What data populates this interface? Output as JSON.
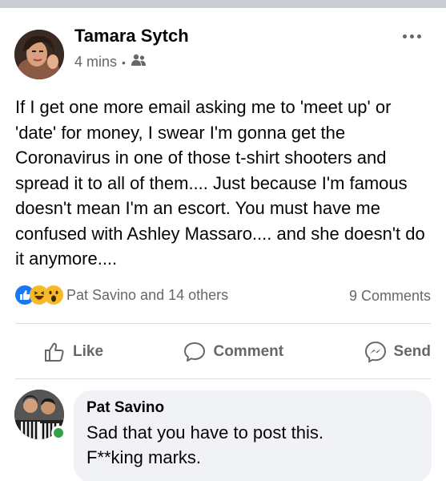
{
  "post": {
    "author": "Tamara Sytch",
    "time": "4 mins",
    "audience_icon": "friends-icon",
    "text": "If I get one more email asking me to 'meet up' or 'date' for money, I swear I'm gonna get the Coronavirus in one of those t-shirt shooters and spread it to all of them.... Just because I'm famous doesn't mean I'm an escort. You must have me confused with Ashley Massaro.... and she doesn't do it anymore....",
    "reactions": {
      "icons": [
        "like-icon",
        "haha-icon",
        "wow-icon"
      ],
      "names": "Pat Savino and 14 others"
    },
    "comments_count": "9 Comments",
    "actions": {
      "like": "Like",
      "comment": "Comment",
      "send": "Send"
    }
  },
  "comment": {
    "author": "Pat Savino",
    "text": "Sad that you have to post this.\nF**king marks.",
    "online": true
  },
  "colors": {
    "like_blue": "#1877f2",
    "reaction_yellow": "#f7b928",
    "online_green": "#31a24c",
    "secondary_text": "#65676b",
    "bubble_bg": "#f0f2f5"
  }
}
